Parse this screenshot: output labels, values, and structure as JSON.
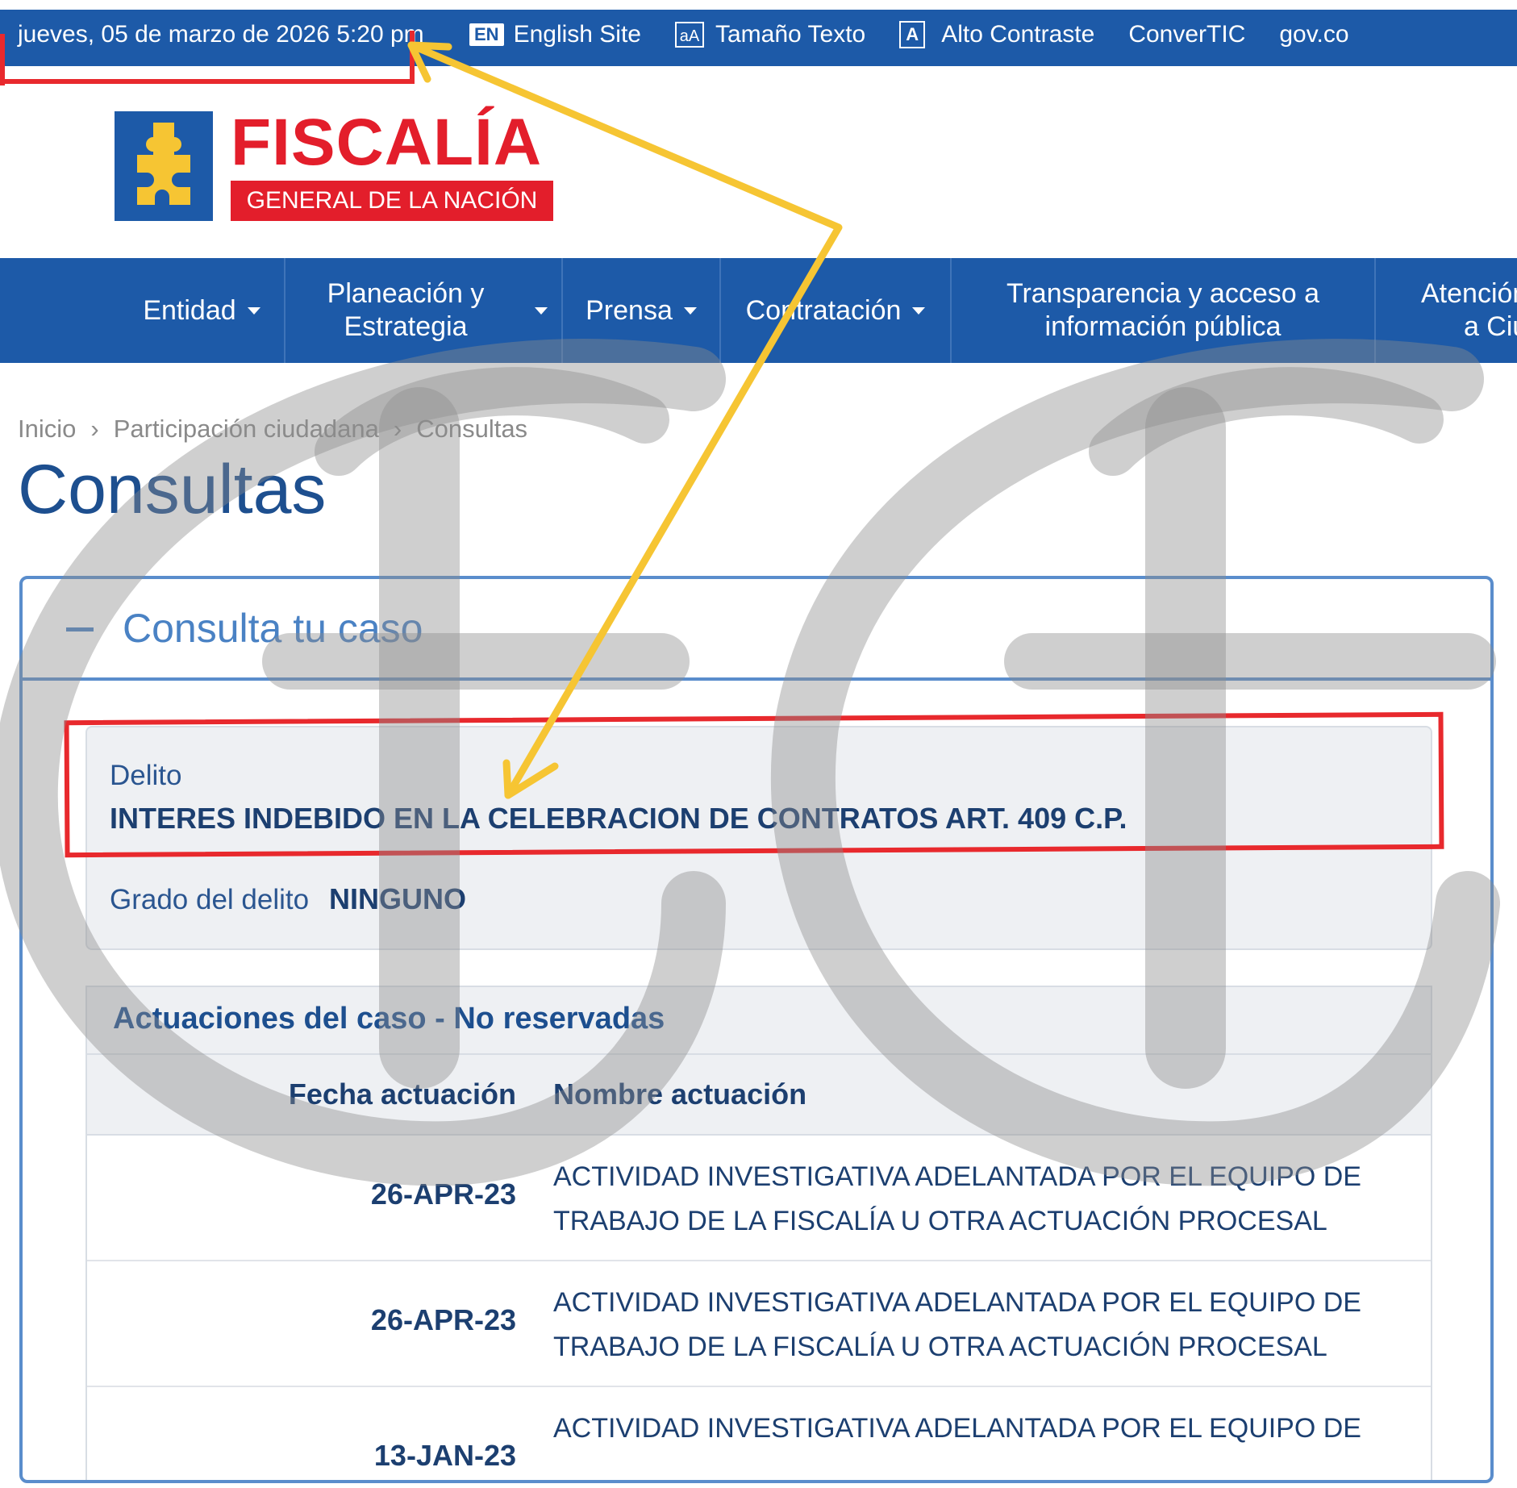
{
  "topbar": {
    "datetime": "jueves, 05 de marzo de 2026 5:20 pm",
    "english_badge": "EN",
    "english_label": "English Site",
    "text_size_icon": "aA",
    "text_size_label": "Tamaño Texto",
    "contrast_icon": "A",
    "contrast_label": "Alto Contraste",
    "convertic_label": "ConverTIC",
    "govco_label": "gov.co"
  },
  "logo": {
    "word": "FISCALÍA",
    "sub": "GENERAL DE LA NACIÓN"
  },
  "nav": {
    "entidad": "Entidad",
    "planeacion_1": "Planeación y",
    "planeacion_2": "Estrategia",
    "prensa": "Prensa",
    "contratacion": "Contratación",
    "transparencia_1": "Transparencia y acceso a",
    "transparencia_2": "información pública",
    "atencion_1": "Atención",
    "atencion_2": "a Ciu"
  },
  "breadcrumb": [
    "Inicio",
    "Participación ciudadana",
    "Consultas"
  ],
  "breadcrumb_sep": "›",
  "page_title": "Consultas",
  "card": {
    "title": "Consulta tu caso",
    "delito_label": "Delito",
    "delito_value": "INTERES INDEBIDO EN LA CELEBRACION DE CONTRATOS ART. 409 C.P.",
    "grado_label": "Grado del delito",
    "grado_value": "NINGUNO"
  },
  "actions": {
    "title": "Actuaciones del caso - No reservadas",
    "col_fecha": "Fecha actuación",
    "col_nombre": "Nombre actuación",
    "rows": [
      {
        "fecha": "26-APR-23",
        "nombre_1": "ACTIVIDAD INVESTIGATIVA ADELANTADA POR EL EQUIPO DE",
        "nombre_2": "TRABAJO DE LA FISCALÍA U OTRA ACTUACIÓN PROCESAL"
      },
      {
        "fecha": "26-APR-23",
        "nombre_1": "ACTIVIDAD INVESTIGATIVA ADELANTADA POR EL EQUIPO DE",
        "nombre_2": "TRABAJO DE LA FISCALÍA U OTRA ACTUACIÓN PROCESAL"
      },
      {
        "fecha": "13-JAN-23",
        "nombre_1": "ACTIVIDAD INVESTIGATIVA ADELANTADA POR EL EQUIPO DE",
        "nombre_2": ""
      }
    ]
  },
  "colors": {
    "brand_blue": "#1d5aa8",
    "brand_red": "#e31e2b",
    "annotation_red": "#e8292d",
    "annotation_yellow": "#f6c533",
    "watermark_gray": "#9a9a9a"
  },
  "icons": [
    "puzzle-logo-icon",
    "caret-down-icon",
    "minus-icon",
    "arrow-annotation",
    "watermark-logo"
  ]
}
